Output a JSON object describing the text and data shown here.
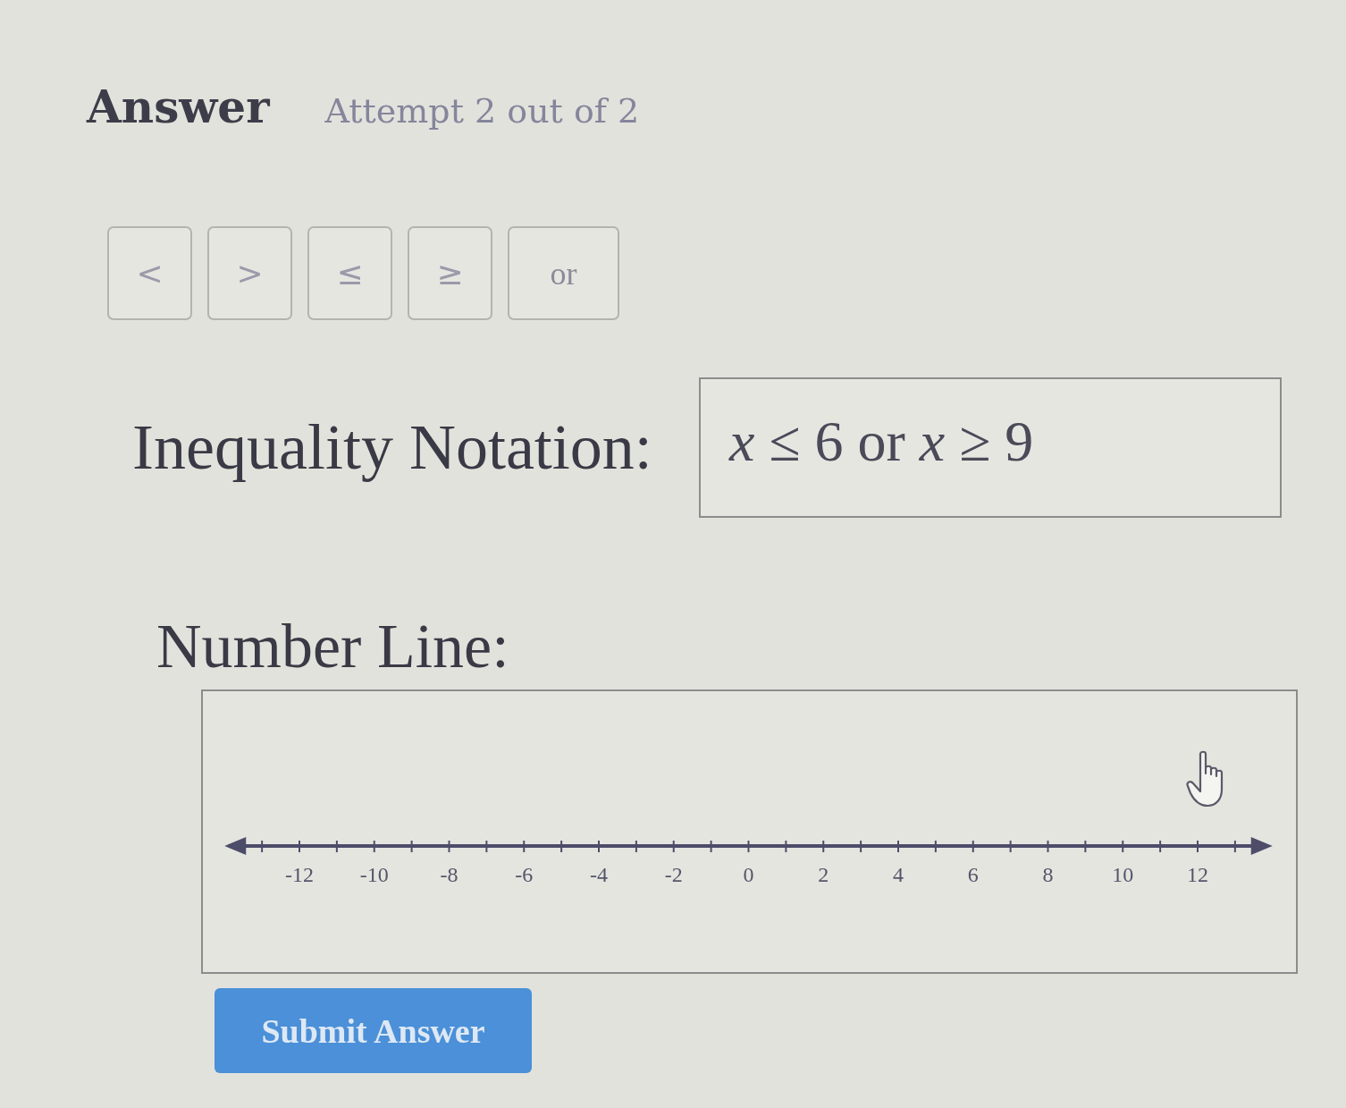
{
  "answer_header": {
    "title": "Answer",
    "attempt": "Attempt 2 out of 2"
  },
  "symbol_buttons": [
    "<",
    ">",
    "≤",
    "≥",
    "or"
  ],
  "inequality_notation": {
    "label": "Inequality Notation:",
    "value": "*x* ≤ 6 or *x* ≥ 9"
  },
  "number_line": {
    "label": "Number Line:",
    "tick_labels": [
      "-12",
      "-10",
      "-8",
      "-6",
      "-4",
      "-2",
      "0",
      "2",
      "4",
      "6",
      "8",
      "10",
      "12"
    ]
  },
  "submit_button": {
    "label": "Submit Answer"
  }
}
